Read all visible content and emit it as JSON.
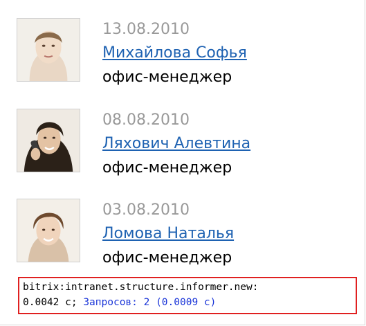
{
  "employees": [
    {
      "date": "13.08.2010",
      "name": "Михайлова Софья",
      "position": "офис-менеджер",
      "avatar_icon": "person-photo-icon"
    },
    {
      "date": "08.08.2010",
      "name": "Ляхович Алевтина",
      "position": "офис-менеджер",
      "avatar_icon": "person-photo-icon"
    },
    {
      "date": "03.08.2010",
      "name": "Ломова Наталья",
      "position": "офис-менеджер",
      "avatar_icon": "person-photo-icon"
    }
  ],
  "debug": {
    "component": "bitrix:intranet.structure.informer.new:",
    "time": "0.0042 с;",
    "queries": "Запросов: 2 (0.0009 с)"
  },
  "colors": {
    "link": "#1e62b2",
    "date": "#999999",
    "debug_border": "#e02020",
    "debug_queries": "#1a35d8"
  }
}
